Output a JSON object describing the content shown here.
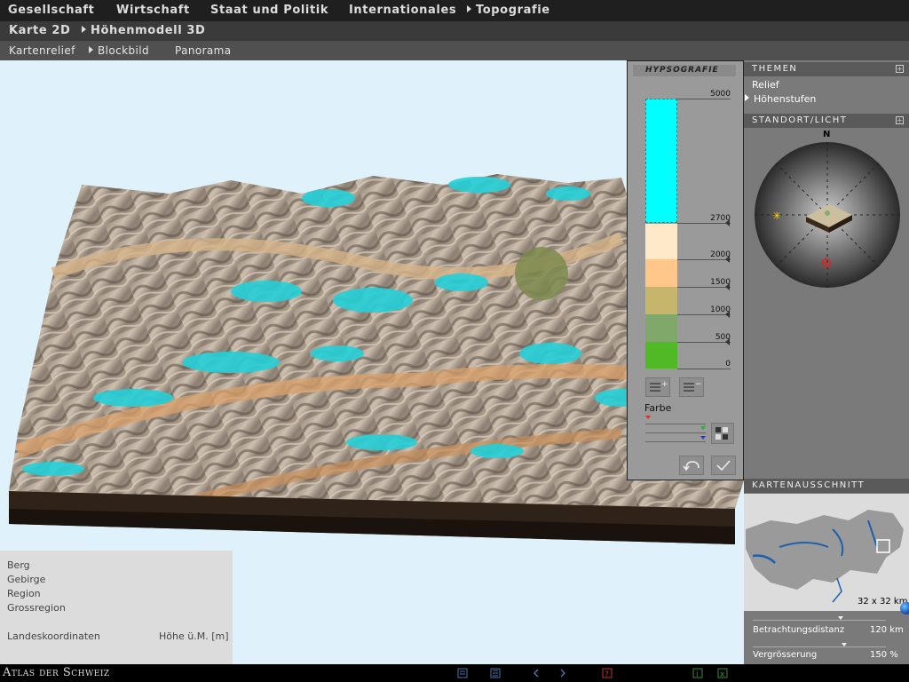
{
  "nav": {
    "top": [
      "Gesellschaft",
      "Wirtschaft",
      "Staat und Politik",
      "Internationales",
      "Topografie"
    ],
    "sub": [
      "Karte 2D",
      "Höhenmodell 3D"
    ],
    "sub2": [
      "Kartenrelief",
      "Blockbild",
      "Panorama"
    ]
  },
  "hypsografie": {
    "title": "HYPSOGRAFIE",
    "levels": [
      "5000",
      "2700",
      "2000",
      "1500",
      "1000",
      "500",
      "0"
    ],
    "colors": [
      "#00ffff",
      "#ffe9c8",
      "#ffc78a",
      "#c5b66c",
      "#7fa86a",
      "#4fba26"
    ],
    "farbe_label": "Farbe"
  },
  "themen": {
    "title": "THEMEN",
    "items": [
      "Relief",
      "Höhenstufen"
    ]
  },
  "standort": {
    "title": "STANDORT/LICHT",
    "north": "N"
  },
  "kartenausschnitt": {
    "title": "KARTENAUSSCHNITT",
    "size": "32 x 32 km",
    "distance_label": "Betrachtungsdistanz",
    "distance_value": "120 km",
    "zoom_label": "Vergrösserung",
    "zoom_value": "150 %"
  },
  "info": {
    "berg": "Berg",
    "gebirge": "Gebirge",
    "region": "Region",
    "grossregion": "Grossregion",
    "koordinaten": "Landeskoordinaten",
    "hoehe": "Höhe ü.M. [m]"
  },
  "footer": {
    "brand": "Atlas der Schweiz"
  }
}
